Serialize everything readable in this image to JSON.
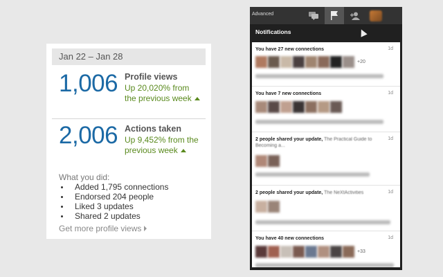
{
  "stats_card": {
    "date_range": "Jan 22 – Jan 28",
    "profile_views": {
      "value": "1,006",
      "label": "Profile views",
      "change": "Up 20,020% from the previous week"
    },
    "actions_taken": {
      "value": "2,006",
      "label": "Actions taken",
      "change": "Up 9,452% from the previous week"
    },
    "what_you_did_title": "What you did:",
    "activities": [
      "Added 1,795 connections",
      "Endorsed 204 people",
      "Liked 3 updates",
      "Shared 2 updates"
    ],
    "more_link": "Get more profile views",
    "accent_color": "#1b69a5",
    "positive_color": "#5a8a1e"
  },
  "notifications_panel": {
    "topbar": {
      "advanced_label": "Advanced",
      "icons": [
        "messages-icon",
        "flag-icon",
        "person-icon",
        "avatar"
      ]
    },
    "title": "Notifications",
    "items": [
      {
        "title": "You have 27 new connections",
        "extra": "",
        "time": "1d",
        "extra_count": "+20"
      },
      {
        "title": "You have 7 new connections",
        "extra": "",
        "time": "1d",
        "extra_count": ""
      },
      {
        "title": "2 people shared your update,",
        "extra": "The Practical Guide to Becoming a...",
        "time": "1d",
        "extra_count": ""
      },
      {
        "title": "2 people shared your update,",
        "extra": "The NeXtActivities",
        "time": "1d",
        "extra_count": ""
      },
      {
        "title": "You have 40 new connections",
        "extra": "",
        "time": "1d",
        "extra_count": "+33"
      }
    ]
  }
}
